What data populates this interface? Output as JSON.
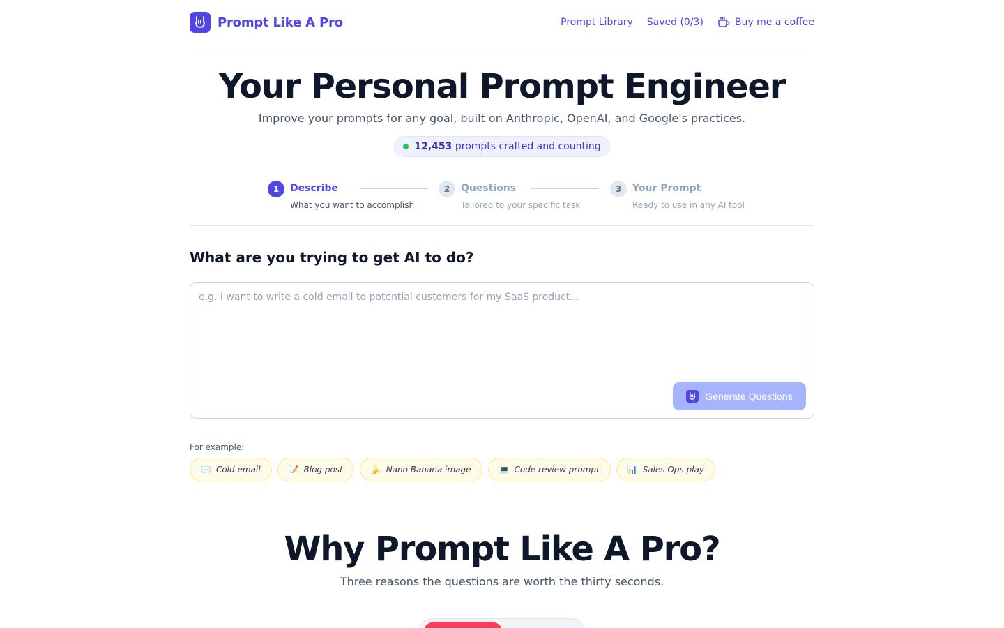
{
  "header": {
    "brand": "Prompt Like A Pro",
    "nav": {
      "library": "Prompt Library",
      "saved": "Saved (0/3)",
      "coffee": "Buy me a coffee"
    }
  },
  "hero": {
    "title": "Your Personal Prompt Engineer",
    "subtitle": "Improve your prompts for any goal, built on Anthropic, OpenAI, and Google's practices.",
    "counter_number": "12,453",
    "counter_text": "prompts crafted and counting"
  },
  "steps": [
    {
      "num": "1",
      "title": "Describe",
      "desc": "What you want to accomplish",
      "state": "active"
    },
    {
      "num": "2",
      "title": "Questions",
      "desc": "Tailored to your specific task",
      "state": "inactive"
    },
    {
      "num": "3",
      "title": "Your Prompt",
      "desc": "Ready to use in any AI tool",
      "state": "inactive"
    }
  ],
  "form": {
    "title": "What are you trying to get AI to do?",
    "placeholder": "e.g. I want to write a cold email to potential customers for my SaaS product...",
    "value": "",
    "button": "Generate Questions"
  },
  "examples": {
    "label": "For example:",
    "chips": [
      {
        "icon": "✉️",
        "label": "Cold email"
      },
      {
        "icon": "📝",
        "label": "Blog post"
      },
      {
        "icon": "🍌",
        "label": "Nano Banana image"
      },
      {
        "icon": "💻",
        "label": "Code review prompt"
      },
      {
        "icon": "📊",
        "label": "Sales Ops play"
      }
    ]
  },
  "why": {
    "title": "Why Prompt Like A Pro?",
    "subtitle": "Three reasons the questions are worth the thirty seconds."
  },
  "colors": {
    "accent": "#4f46e5",
    "button_disabled": "#a5b4fc",
    "chip_bg": "#fefce8",
    "status_dot": "#22c55e",
    "toggle_active": "#f43f5e"
  }
}
